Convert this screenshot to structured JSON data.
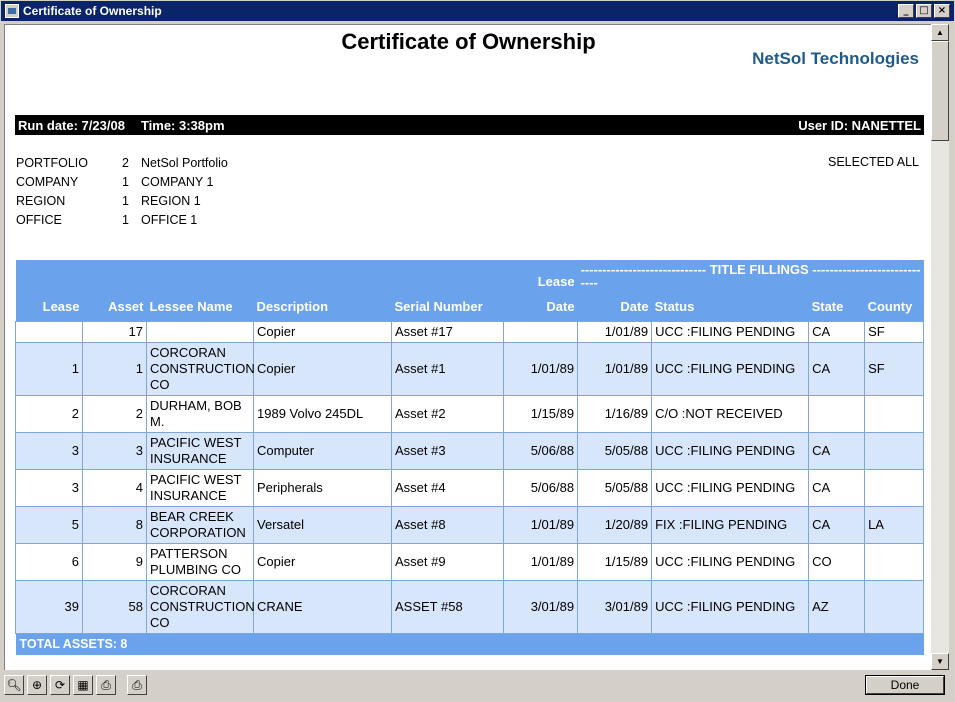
{
  "window": {
    "title": "Certificate of Ownership"
  },
  "report": {
    "title": "Certificate of Ownership",
    "brand": "NetSol Technologies",
    "run_date": "Run date: 7/23/08",
    "time": "Time: 3:38pm",
    "user_id": "User ID: NANETTEL",
    "selected": "SELECTED ALL",
    "params": [
      {
        "label": "PORTFOLIO",
        "num": "2",
        "name": "NetSol Portfolio"
      },
      {
        "label": "COMPANY",
        "num": "1",
        "name": "COMPANY 1"
      },
      {
        "label": "REGION",
        "num": "1",
        "name": "REGION 1"
      },
      {
        "label": "OFFICE",
        "num": "1",
        "name": "OFFICE 1"
      }
    ],
    "header": {
      "lease_top": "Lease",
      "filling_group": "----------------------------- TITLE FILLINGS -----------------------------",
      "lease": "Lease",
      "asset": "Asset",
      "lessee": "Lessee Name",
      "description": "Description",
      "serial": "Serial Number",
      "lease_date": "Date",
      "date": "Date",
      "status": "Status",
      "state": "State",
      "county": "County"
    },
    "rows": [
      {
        "lease": "",
        "asset": "17",
        "lessee": "",
        "description": "Copier",
        "serial": "Asset #17",
        "lease_date": "",
        "date": "1/01/89",
        "status": "UCC :FILING PENDING",
        "state": "CA",
        "county": "SF"
      },
      {
        "lease": "1",
        "asset": "1",
        "lessee": "CORCORAN CONSTRUCTION CO",
        "description": "Copier",
        "serial": "Asset #1",
        "lease_date": "1/01/89",
        "date": "1/01/89",
        "status": "UCC :FILING PENDING",
        "state": "CA",
        "county": "SF"
      },
      {
        "lease": "2",
        "asset": "2",
        "lessee": "DURHAM, BOB M.",
        "description": "1989 Volvo 245DL",
        "serial": "Asset #2",
        "lease_date": "1/15/89",
        "date": "1/16/89",
        "status": "C/O :NOT RECEIVED",
        "state": "",
        "county": ""
      },
      {
        "lease": "3",
        "asset": "3",
        "lessee": "PACIFIC WEST INSURANCE",
        "description": "Computer",
        "serial": "Asset #3",
        "lease_date": "5/06/88",
        "date": "5/05/88",
        "status": "UCC :FILING PENDING",
        "state": "CA",
        "county": ""
      },
      {
        "lease": "3",
        "asset": "4",
        "lessee": "PACIFIC WEST INSURANCE",
        "description": "Peripherals",
        "serial": "Asset #4",
        "lease_date": "5/06/88",
        "date": "5/05/88",
        "status": "UCC :FILING PENDING",
        "state": "CA",
        "county": ""
      },
      {
        "lease": "5",
        "asset": "8",
        "lessee": "BEAR CREEK CORPORATION",
        "description": "Versatel",
        "serial": "Asset #8",
        "lease_date": "1/01/89",
        "date": "1/20/89",
        "status": "FIX :FILING PENDING",
        "state": "CA",
        "county": "LA"
      },
      {
        "lease": "6",
        "asset": "9",
        "lessee": "PATTERSON PLUMBING CO",
        "description": "Copier",
        "serial": "Asset #9",
        "lease_date": "1/01/89",
        "date": "1/15/89",
        "status": "UCC :FILING PENDING",
        "state": "CO",
        "county": ""
      },
      {
        "lease": "39",
        "asset": "58",
        "lessee": "CORCORAN CONSTRUCTION CO",
        "description": "CRANE",
        "serial": "ASSET #58",
        "lease_date": "3/01/89",
        "date": "3/01/89",
        "status": "UCC :FILING PENDING",
        "state": "AZ",
        "county": ""
      }
    ],
    "total": "TOTAL ASSETS: 8"
  },
  "toolbar": {
    "icons": [
      "zoom-out-icon",
      "zoom-in-icon",
      "refresh-icon",
      "excel-export-icon",
      "print-setup-icon",
      "print-icon"
    ],
    "done_label": "Done"
  }
}
